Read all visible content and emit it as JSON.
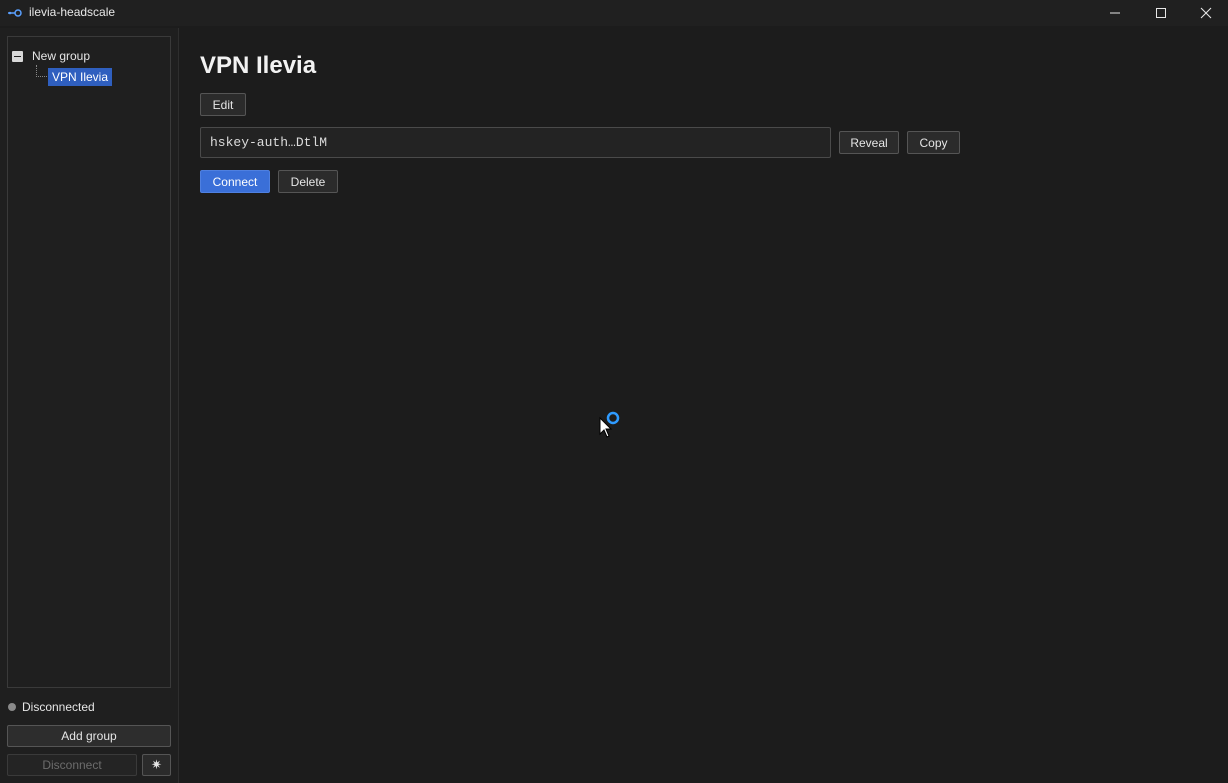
{
  "window": {
    "title": "ilevia-headscale",
    "controls": {
      "minimize_icon": "minimize-icon",
      "maximize_icon": "maximize-icon",
      "close_icon": "close-icon"
    }
  },
  "sidebar": {
    "tree": {
      "groups": [
        {
          "label": "New group",
          "expanded": true,
          "items": [
            {
              "label": "VPN Ilevia",
              "selected": true
            }
          ]
        }
      ]
    },
    "status": {
      "text": "Disconnected",
      "dot_color": "#8a8a8a"
    },
    "add_group_label": "Add group",
    "disconnect_label": "Disconnect",
    "settings_glyph": "✷"
  },
  "main": {
    "title": "VPN Ilevia",
    "edit_label": "Edit",
    "auth_key": {
      "value": "hskey-auth…DtlM"
    },
    "reveal_label": "Reveal",
    "copy_label": "Copy",
    "connect_label": "Connect",
    "delete_label": "Delete"
  },
  "colors": {
    "accent": "#3a6fd8",
    "selection": "#2f5fbf",
    "background": "#1c1c1c"
  }
}
